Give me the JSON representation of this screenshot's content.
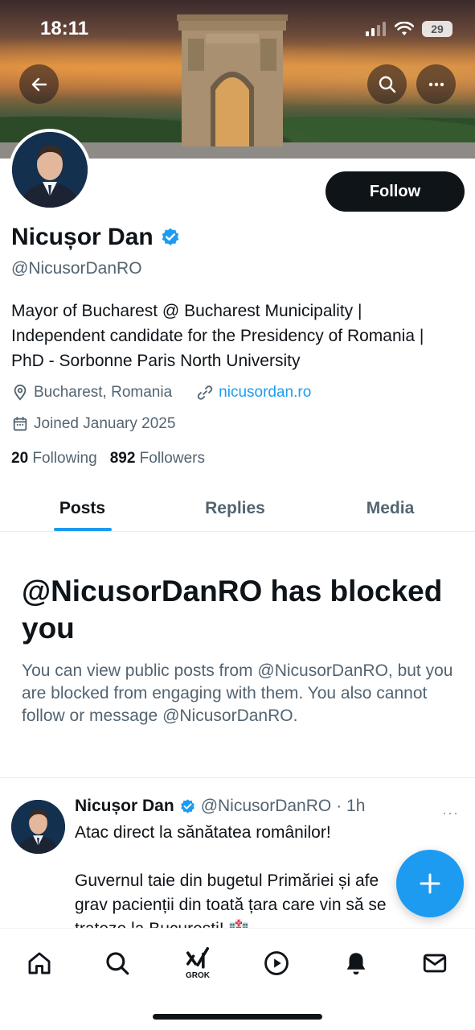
{
  "status": {
    "time": "18:11",
    "battery": "29"
  },
  "profile": {
    "name": "Nicușor Dan",
    "handle": "@NicusorDanRO",
    "bio_lines": [
      "Mayor of Bucharest @ Bucharest Municipality |",
      "Independent candidate for the Presidency of Romania |",
      "PhD - Sorbonne Paris North University"
    ],
    "location": "Bucharest, Romania",
    "website": "nicusordan.ro",
    "joined": "Joined January 2025",
    "following_count": "20",
    "following_label": "Following",
    "followers_count": "892",
    "followers_label": "Followers",
    "follow_label": "Follow"
  },
  "tabs": [
    {
      "label": "Posts",
      "active": true
    },
    {
      "label": "Replies",
      "active": false
    },
    {
      "label": "Media",
      "active": false
    }
  ],
  "blocked": {
    "title": "@NicusorDanRO has blocked you",
    "description": "You can view public posts from @NicusorDanRO, but you are blocked from engaging with them. You also cannot follow or message @NicusorDanRO."
  },
  "post": {
    "name": "Nicușor Dan",
    "handle": "@NicusorDanRO",
    "time": "· 1h",
    "more": "···",
    "lines": [
      "Atac direct la sănătatea românilor!",
      "",
      "Guvernul taie din bugetul Primăriei și afe",
      "grav pacienții din toată țara care vin să se",
      "trateze la București! 🏥"
    ]
  },
  "nav": {
    "grok_label": "GROK"
  },
  "colors": {
    "accent": "#1d9bf0",
    "text": "#0f1419",
    "muted": "#536471"
  }
}
